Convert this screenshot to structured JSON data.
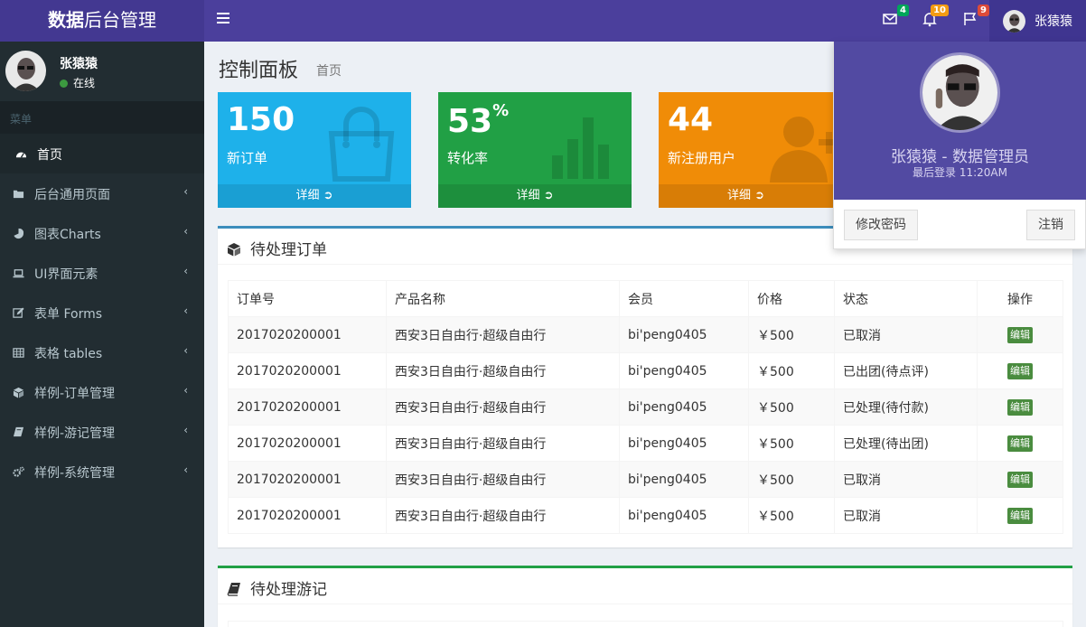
{
  "header": {
    "logo_bold": "数据",
    "logo_rest": "后台管理",
    "mail_count": "4",
    "bell_count": "10",
    "flag_count": "9",
    "user_name": "张猿猿",
    "colors": {
      "mail_badge": "#00a65a",
      "bell_badge": "#f39c12",
      "flag_badge": "#dd4b39"
    }
  },
  "sidebar": {
    "user_name": "张猿猿",
    "status": "在线",
    "menu_header": "菜单",
    "items": [
      {
        "label": "首页",
        "icon": "dashboard-icon"
      },
      {
        "label": "后台通用页面",
        "icon": "folder-icon"
      },
      {
        "label": "图表Charts",
        "icon": "pie-chart-icon"
      },
      {
        "label": "UI界面元素",
        "icon": "laptop-icon"
      },
      {
        "label": "表单 Forms",
        "icon": "edit-icon"
      },
      {
        "label": "表格 tables",
        "icon": "table-icon"
      },
      {
        "label": "样例-订单管理",
        "icon": "cube-icon"
      },
      {
        "label": "样例-游记管理",
        "icon": "book-icon"
      },
      {
        "label": "样例-系统管理",
        "icon": "cogs-icon"
      }
    ]
  },
  "page": {
    "title": "控制面板",
    "subtitle": "首页"
  },
  "boxes": [
    {
      "value": "150",
      "suffix": "",
      "label": "新订单",
      "more": "详细",
      "color": "#1eb1ea",
      "footer_color": "#1a9fd3",
      "icon": "shopping-bag-icon"
    },
    {
      "value": "53",
      "suffix": "%",
      "label": "转化率",
      "more": "详细",
      "color": "#21a045",
      "footer_color": "#1d8f3d",
      "icon": "bar-chart-icon"
    },
    {
      "value": "44",
      "suffix": "",
      "label": "新注册用户",
      "more": "详细",
      "color": "#f08c07",
      "footer_color": "#d87d06",
      "icon": "user-plus-icon"
    }
  ],
  "orders": {
    "title": "待处理订单",
    "columns": [
      "订单号",
      "产品名称",
      "会员",
      "价格",
      "状态",
      "操作"
    ],
    "rows": [
      {
        "id": "2017020200001",
        "product": "西安3日自由行·超级自由行",
        "member": "bi'peng0405",
        "price": "￥500",
        "status": "已取消",
        "action": "编辑"
      },
      {
        "id": "2017020200001",
        "product": "西安3日自由行·超级自由行",
        "member": "bi'peng0405",
        "price": "￥500",
        "status": "已出团(待点评)",
        "action": "编辑"
      },
      {
        "id": "2017020200001",
        "product": "西安3日自由行·超级自由行",
        "member": "bi'peng0405",
        "price": "￥500",
        "status": "已处理(待付款)",
        "action": "编辑"
      },
      {
        "id": "2017020200001",
        "product": "西安3日自由行·超级自由行",
        "member": "bi'peng0405",
        "price": "￥500",
        "status": "已处理(待出团)",
        "action": "编辑"
      },
      {
        "id": "2017020200001",
        "product": "西安3日自由行·超级自由行",
        "member": "bi'peng0405",
        "price": "￥500",
        "status": "已取消",
        "action": "编辑"
      },
      {
        "id": "2017020200001",
        "product": "西安3日自由行·超级自由行",
        "member": "bi'peng0405",
        "price": "￥500",
        "status": "已取消",
        "action": "编辑"
      }
    ]
  },
  "travels": {
    "title": "待处理游记"
  },
  "dropdown": {
    "name_line": "张猿猿 - 数据管理员",
    "last_login": "最后登录 11:20AM",
    "change_password": "修改密码",
    "logout": "注销"
  }
}
